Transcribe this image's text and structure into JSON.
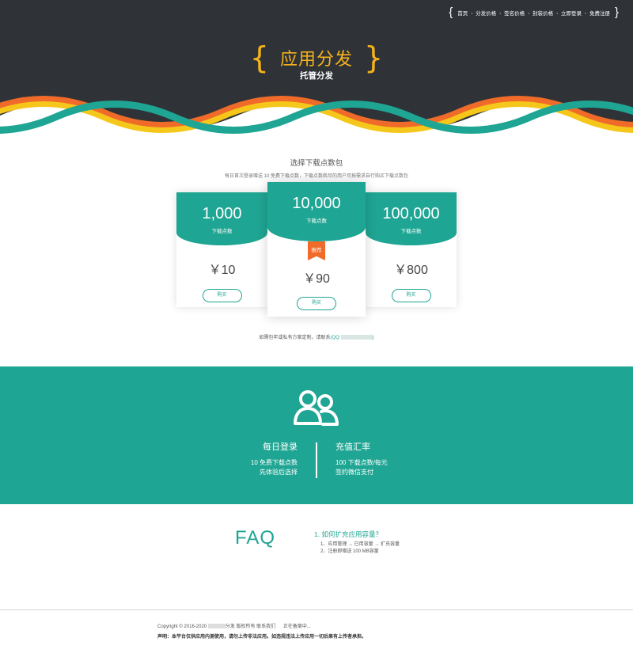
{
  "nav": {
    "items": [
      "首页",
      "分发价格",
      "签名价格",
      "封装价格",
      "立即登录",
      "免费注册"
    ]
  },
  "hero": {
    "title": "应用分发",
    "subtitle": "托管分发"
  },
  "pricing": {
    "heading": "选择下载点数包",
    "desc": "每日首次登录赠送 10 免费下载点数，下载点数耗尽的用户可按需求自行购买下载点数包",
    "unit_label": "下载点数",
    "buy_label": "购买",
    "badge": "推荐",
    "packages": [
      {
        "amount": "1,000",
        "price": "￥10"
      },
      {
        "amount": "10,000",
        "price": "￥90"
      },
      {
        "amount": "100,000",
        "price": "￥800"
      }
    ],
    "contact_text": "如需包年或私有方案定制，请联系",
    "contact_qq": "QQ"
  },
  "features": {
    "left": {
      "title": "每日登录",
      "line1": "10 免费下载点数",
      "line2": "先体验后选择"
    },
    "right": {
      "title": "充值汇率",
      "line1": "100 下载点数/每元",
      "line2": "签约微信支付"
    }
  },
  "faq": {
    "title": "FAQ",
    "question": "1. 如何扩充应用容量？",
    "answer1": "1、应用管理 → 已用容量 → 扩充容量",
    "answer2": "2、注册即赠送 100 MB容量"
  },
  "footer": {
    "copyright": "Copyright © 2016-2020",
    "rights": "分发 版权所有",
    "contact": "联系我们",
    "icp": "正在备案中...",
    "statement": "声明：本平台仅供应用内测使用，请勿上传非法应用。如违规违法上传应用一切后果有上传者承担。"
  },
  "colors": {
    "teal": "#1fa593",
    "dark": "#2f3337",
    "gold": "#f5b31b",
    "orange": "#f06b29"
  }
}
